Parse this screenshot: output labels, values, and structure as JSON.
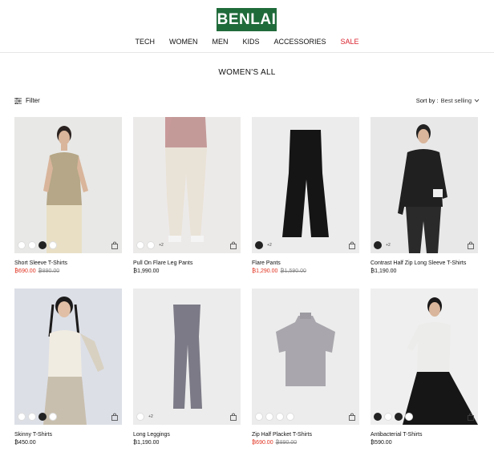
{
  "brand": {
    "logo_text": "BENLAI",
    "color": "#1f6b3a"
  },
  "nav": [
    {
      "label": "TECH"
    },
    {
      "label": "WOMEN"
    },
    {
      "label": "MEN"
    },
    {
      "label": "KIDS"
    },
    {
      "label": "ACCESSORIES"
    },
    {
      "label": "SALE",
      "color": "#d9232d"
    }
  ],
  "page": {
    "title": "WOMEN'S ALL"
  },
  "toolbar": {
    "filter_label": "Filter",
    "sort_label": "Sort by :",
    "sort_value": "Best selling"
  },
  "products": [
    {
      "name": "Short Sleeve T-Shirts",
      "price": "₿690.00",
      "original_price": "₿890.00",
      "on_sale": true,
      "more": ""
    },
    {
      "name": "Pull On Flare Leg Pants",
      "price": "₿1,990.00",
      "original_price": "",
      "on_sale": false,
      "more": "+2"
    },
    {
      "name": "Flare Pants",
      "price": "₿1,290.00",
      "original_price": "₿1,590.00",
      "on_sale": true,
      "more": "+2"
    },
    {
      "name": "Contrast Half Zip Long Sleeve T-Shirts",
      "price": "₿1,190.00",
      "original_price": "",
      "on_sale": false,
      "more": "+2"
    },
    {
      "name": "Skinny T-Shirts",
      "price": "₿450.00",
      "original_price": "",
      "on_sale": false,
      "more": ""
    },
    {
      "name": "Long Leggings",
      "price": "₿1,190.00",
      "original_price": "",
      "on_sale": false,
      "more": "+2"
    },
    {
      "name": "Zip Half Placket T-Shirts",
      "price": "₿690.00",
      "original_price": "₿890.00",
      "on_sale": true,
      "more": ""
    },
    {
      "name": "Antibacterial T-Shirts",
      "price": "₿590.00",
      "original_price": "",
      "on_sale": false,
      "more": ""
    }
  ],
  "icons": {
    "filter": "filter-icon",
    "sort": "chevron-down-icon",
    "bag": "shopping-bag-icon"
  },
  "colors": {
    "sale": "#e0311f",
    "accent": "#1f6b3a"
  }
}
